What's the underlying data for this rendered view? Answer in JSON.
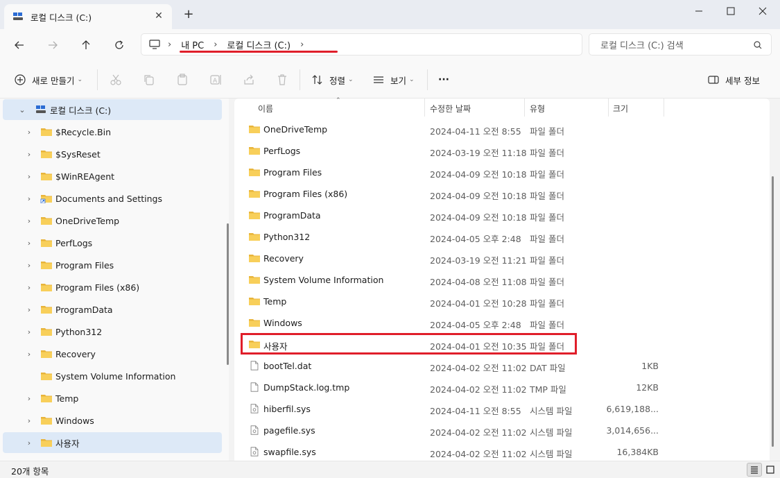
{
  "tab": {
    "title": "로컬 디스크 (C:)",
    "close_icon": "close-icon"
  },
  "breadcrumb": [
    "내 PC",
    "로컬 디스크 (C:)"
  ],
  "search": {
    "placeholder": "로컬 디스크 (C:) 검색"
  },
  "toolbar": {
    "new_label": "새로 만들기",
    "sort_label": "정렬",
    "view_label": "보기",
    "more_label": "···",
    "details_label": "세부 정보"
  },
  "sidebar": {
    "root": "로컬 디스크 (C:)",
    "items": [
      {
        "label": "$Recycle.Bin",
        "expandable": true,
        "icon": "folder-icon"
      },
      {
        "label": "$SysReset",
        "expandable": true,
        "icon": "folder-icon"
      },
      {
        "label": "$WinREAgent",
        "expandable": true,
        "icon": "folder-icon"
      },
      {
        "label": "Documents and Settings",
        "expandable": true,
        "icon": "folder-shortcut-icon"
      },
      {
        "label": "OneDriveTemp",
        "expandable": true,
        "icon": "folder-icon"
      },
      {
        "label": "PerfLogs",
        "expandable": true,
        "icon": "folder-icon"
      },
      {
        "label": "Program Files",
        "expandable": true,
        "icon": "folder-icon"
      },
      {
        "label": "Program Files (x86)",
        "expandable": true,
        "icon": "folder-icon"
      },
      {
        "label": "ProgramData",
        "expandable": true,
        "icon": "folder-icon"
      },
      {
        "label": "Python312",
        "expandable": true,
        "icon": "folder-icon"
      },
      {
        "label": "Recovery",
        "expandable": true,
        "icon": "folder-icon"
      },
      {
        "label": "System Volume Information",
        "expandable": false,
        "icon": "folder-icon"
      },
      {
        "label": "Temp",
        "expandable": true,
        "icon": "folder-icon"
      },
      {
        "label": "Windows",
        "expandable": true,
        "icon": "folder-icon"
      },
      {
        "label": "사용자",
        "expandable": true,
        "icon": "folder-icon",
        "selected": true
      }
    ]
  },
  "columns": {
    "name": "이름",
    "date": "수정한 날짜",
    "type": "유형",
    "size": "크기"
  },
  "files": [
    {
      "name": "OneDriveTemp",
      "date": "2024-04-11 오전 8:55",
      "type": "파일 폴더",
      "size": "",
      "kind": "folder"
    },
    {
      "name": "PerfLogs",
      "date": "2024-03-19 오전 11:18",
      "type": "파일 폴더",
      "size": "",
      "kind": "folder"
    },
    {
      "name": "Program Files",
      "date": "2024-04-09 오전 10:18",
      "type": "파일 폴더",
      "size": "",
      "kind": "folder"
    },
    {
      "name": "Program Files (x86)",
      "date": "2024-04-09 오전 10:18",
      "type": "파일 폴더",
      "size": "",
      "kind": "folder"
    },
    {
      "name": "ProgramData",
      "date": "2024-04-09 오전 10:18",
      "type": "파일 폴더",
      "size": "",
      "kind": "folder"
    },
    {
      "name": "Python312",
      "date": "2024-04-05 오후 2:48",
      "type": "파일 폴더",
      "size": "",
      "kind": "folder"
    },
    {
      "name": "Recovery",
      "date": "2024-03-19 오전 11:21",
      "type": "파일 폴더",
      "size": "",
      "kind": "folder"
    },
    {
      "name": "System Volume Information",
      "date": "2024-04-08 오전 11:08",
      "type": "파일 폴더",
      "size": "",
      "kind": "folder"
    },
    {
      "name": "Temp",
      "date": "2024-04-01 오전 10:28",
      "type": "파일 폴더",
      "size": "",
      "kind": "folder"
    },
    {
      "name": "Windows",
      "date": "2024-04-05 오후 2:48",
      "type": "파일 폴더",
      "size": "",
      "kind": "folder"
    },
    {
      "name": "사용자",
      "date": "2024-04-01 오전 10:35",
      "type": "파일 폴더",
      "size": "",
      "kind": "folder",
      "highlighted": true
    },
    {
      "name": "bootTel.dat",
      "date": "2024-04-02 오전 11:02",
      "type": "DAT 파일",
      "size": "1KB",
      "kind": "file"
    },
    {
      "name": "DumpStack.log.tmp",
      "date": "2024-04-02 오전 11:02",
      "type": "TMP 파일",
      "size": "12KB",
      "kind": "file"
    },
    {
      "name": "hiberfil.sys",
      "date": "2024-04-11 오전 8:55",
      "type": "시스템 파일",
      "size": "6,619,188...",
      "kind": "sysfile"
    },
    {
      "name": "pagefile.sys",
      "date": "2024-04-02 오전 11:02",
      "type": "시스템 파일",
      "size": "3,014,656...",
      "kind": "sysfile"
    },
    {
      "name": "swapfile.sys",
      "date": "2024-04-02 오전 11:02",
      "type": "시스템 파일",
      "size": "16,384KB",
      "kind": "sysfile"
    }
  ],
  "status": {
    "count": "20개 항목"
  },
  "colors": {
    "accent_red": "#e01e2a",
    "folder_yellow": "#f5c542",
    "selected_bg": "#dde9f7"
  }
}
